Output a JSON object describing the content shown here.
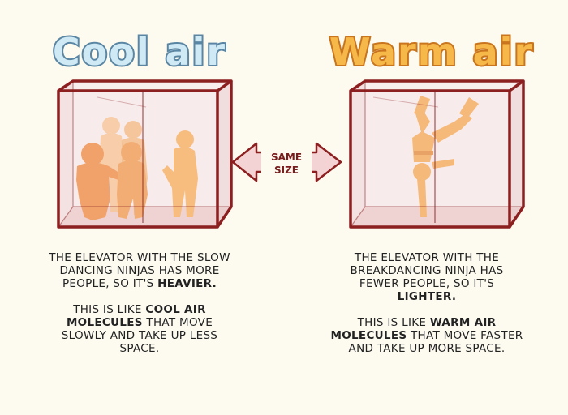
{
  "left_panel": {
    "title": "Cool air",
    "caption1_pre": "THE ELEVATOR WITH THE SLOW DANCING NINJAS HAS MORE PEOPLE, SO IT'S",
    "caption1_bold": "HEAVIER.",
    "caption2_pre": "THIS IS LIKE",
    "caption2_bold": "COOL AIR MOLECULES",
    "caption2_post": "THAT MOVE SLOWLY AND TAKE UP LESS SPACE."
  },
  "right_panel": {
    "title": "Warm air",
    "caption1_pre": "THE ELEVATOR WITH THE BREAKDANCING NINJA HAS FEWER PEOPLE, SO IT'S",
    "caption1_bold": "LIGHTER.",
    "caption2_pre": "THIS IS LIKE",
    "caption2_bold": "WARM AIR MOLECULES",
    "caption2_post": "THAT MOVE FASTER AND TAKE UP MORE SPACE."
  },
  "arrow": {
    "line1": "SAME",
    "line2": "SIZE"
  },
  "colors": {
    "cool_title_fill": "#cfe9f5",
    "cool_title_stroke": "#5a86a3",
    "warm_title_fill": "#f7b84a",
    "warm_title_stroke": "#c9751d",
    "box_frame": "#8c1f1f",
    "box_fill": "#f6e6e6",
    "ninja_orange": "#f39c3d",
    "ninja_deep": "#ee7e2a",
    "arrow_fill": "#f3d3d3",
    "arrow_stroke": "#8c1f1f"
  }
}
